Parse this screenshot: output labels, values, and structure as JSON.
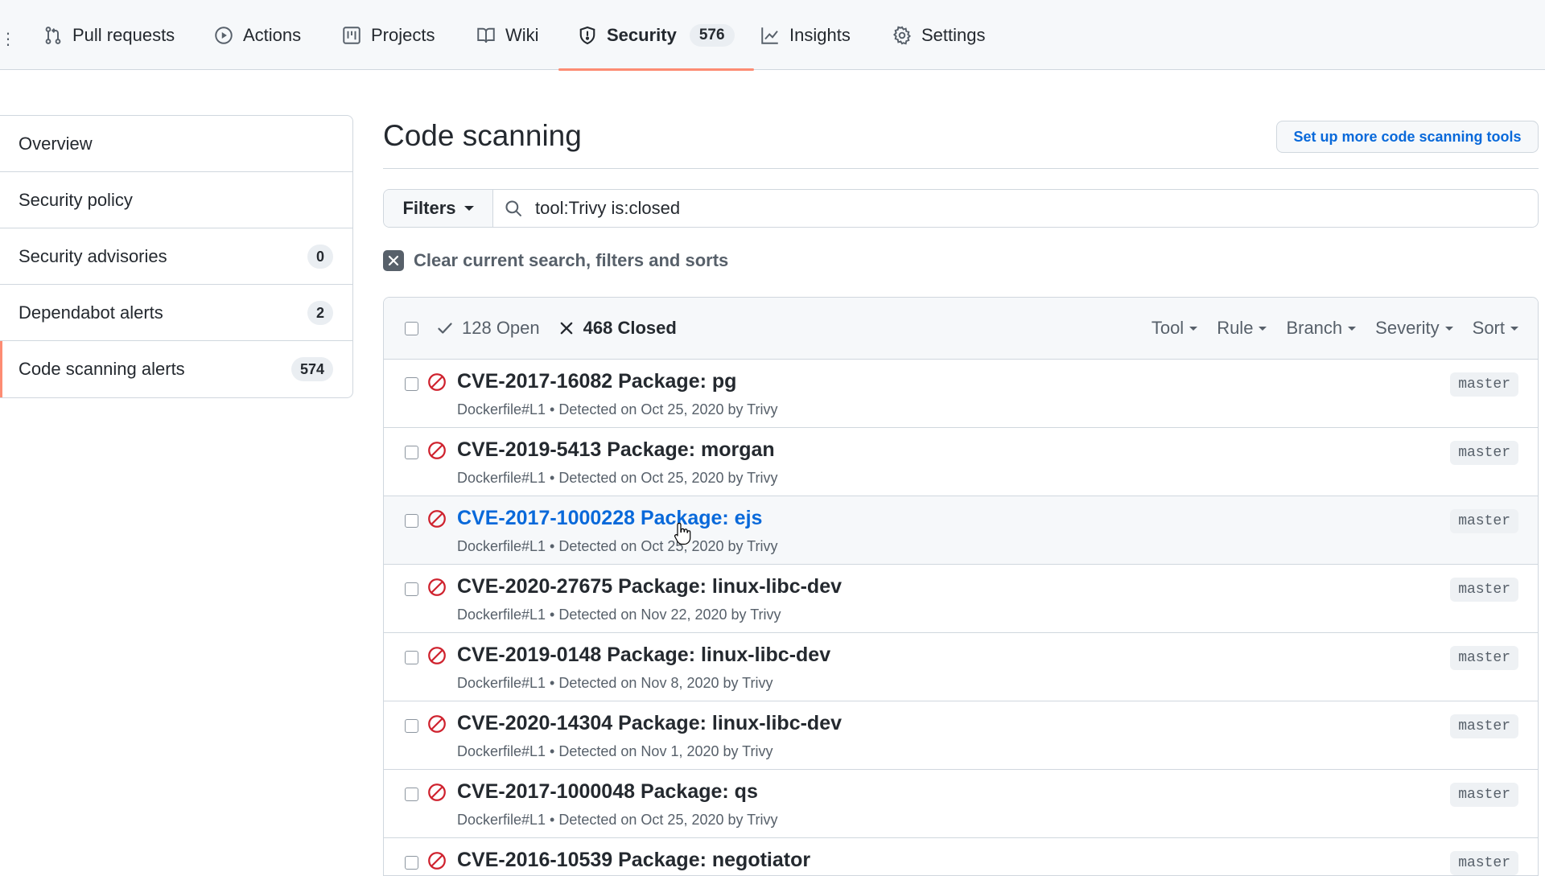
{
  "repo_nav": {
    "tabs": [
      {
        "label": "Pull requests",
        "icon": "git-pull-request-icon"
      },
      {
        "label": "Actions",
        "icon": "play-icon"
      },
      {
        "label": "Projects",
        "icon": "project-icon"
      },
      {
        "label": "Wiki",
        "icon": "book-icon"
      },
      {
        "label": "Security",
        "icon": "shield-icon",
        "counter": "576",
        "selected": true
      },
      {
        "label": "Insights",
        "icon": "graph-icon"
      },
      {
        "label": "Settings",
        "icon": "gear-icon"
      }
    ]
  },
  "sidebar": {
    "items": [
      {
        "label": "Overview"
      },
      {
        "label": "Security policy"
      },
      {
        "label": "Security advisories",
        "count": "0"
      },
      {
        "label": "Dependabot alerts",
        "count": "2"
      },
      {
        "label": "Code scanning alerts",
        "count": "574",
        "selected": true
      }
    ]
  },
  "main": {
    "title": "Code scanning",
    "setup_button": "Set up more code scanning tools",
    "filters_button": "Filters",
    "search_value": "tool:Trivy is:closed",
    "clear_label": "Clear current search, filters and sorts"
  },
  "alerts_header": {
    "open_label": "128 Open",
    "closed_label": "468 Closed",
    "filters": [
      "Tool",
      "Rule",
      "Branch",
      "Severity",
      "Sort"
    ]
  },
  "alerts": [
    {
      "title": "CVE-2017-16082 Package: pg",
      "meta": "Dockerfile#L1 • Detected on Oct 25, 2020 by Trivy",
      "branch": "master"
    },
    {
      "title": "CVE-2019-5413 Package: morgan",
      "meta": "Dockerfile#L1 • Detected on Oct 25, 2020 by Trivy",
      "branch": "master"
    },
    {
      "title": "CVE-2017-1000228 Package: ejs",
      "meta": "Dockerfile#L1 • Detected on Oct 25, 2020 by Trivy",
      "branch": "master",
      "hover": true
    },
    {
      "title": "CVE-2020-27675 Package: linux-libc-dev",
      "meta": "Dockerfile#L1 • Detected on Nov 22, 2020 by Trivy",
      "branch": "master"
    },
    {
      "title": "CVE-2019-0148 Package: linux-libc-dev",
      "meta": "Dockerfile#L1 • Detected on Nov 8, 2020 by Trivy",
      "branch": "master"
    },
    {
      "title": "CVE-2020-14304 Package: linux-libc-dev",
      "meta": "Dockerfile#L1 • Detected on Nov 1, 2020 by Trivy",
      "branch": "master"
    },
    {
      "title": "CVE-2017-1000048 Package: qs",
      "meta": "Dockerfile#L1 • Detected on Oct 25, 2020 by Trivy",
      "branch": "master"
    },
    {
      "title": "CVE-2016-10539 Package: negotiator",
      "meta": "",
      "branch": "master"
    }
  ],
  "colors": {
    "accent_underline": "#fd8c73",
    "link_blue": "#0969da",
    "alert_red": "#cf222e"
  }
}
